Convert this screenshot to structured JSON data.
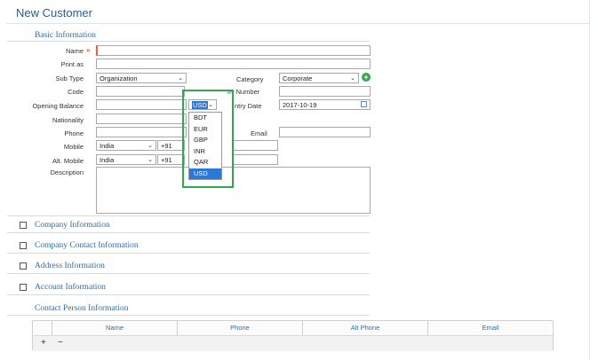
{
  "page": {
    "title": "New Customer"
  },
  "sections": {
    "basic": "Basic Information",
    "company": "Company Information",
    "company_contact": "Company Contact Information",
    "address": "Address Information",
    "account": "Account Information",
    "contact_person": "Contact Person Information"
  },
  "labels": {
    "name": "Name",
    "print_as": "Print as",
    "sub_type": "Sub Type",
    "code": "Code",
    "opening_balance": "Opening Balance",
    "nationality": "Nationality",
    "phone": "Phone",
    "mobile": "Mobile",
    "alt_mobile": "Alt. Mobile",
    "description": "Description",
    "category": "Category",
    "vat_number": "IN Number",
    "entry_date": "ntry Date",
    "email": "Email"
  },
  "fields": {
    "name": "",
    "print_as": "",
    "sub_type": "Organization",
    "code": "",
    "opening_balance": "",
    "currency": "USD",
    "nationality": "",
    "phone": "",
    "mobile_country": "India",
    "mobile_code": "+91",
    "mobile_number": "",
    "alt_mobile_country": "India",
    "alt_mobile_code": "+91",
    "alt_mobile_number": "",
    "description": "",
    "category": "Corporate",
    "vat_number": "",
    "entry_date": "2017-10-19",
    "email": ""
  },
  "currency_options": [
    "BDT",
    "EUR",
    "GBP",
    "INR",
    "QAR",
    "USD"
  ],
  "contact_grid": {
    "columns": [
      "Name",
      "Phone",
      "Alt Phone",
      "Email"
    ],
    "add_label": "+",
    "remove_label": "−"
  },
  "colors": {
    "accent": "#2e6db3",
    "highlight": "#2fa84f",
    "required": "#e8642c",
    "add_icon": "#2fa84f"
  }
}
